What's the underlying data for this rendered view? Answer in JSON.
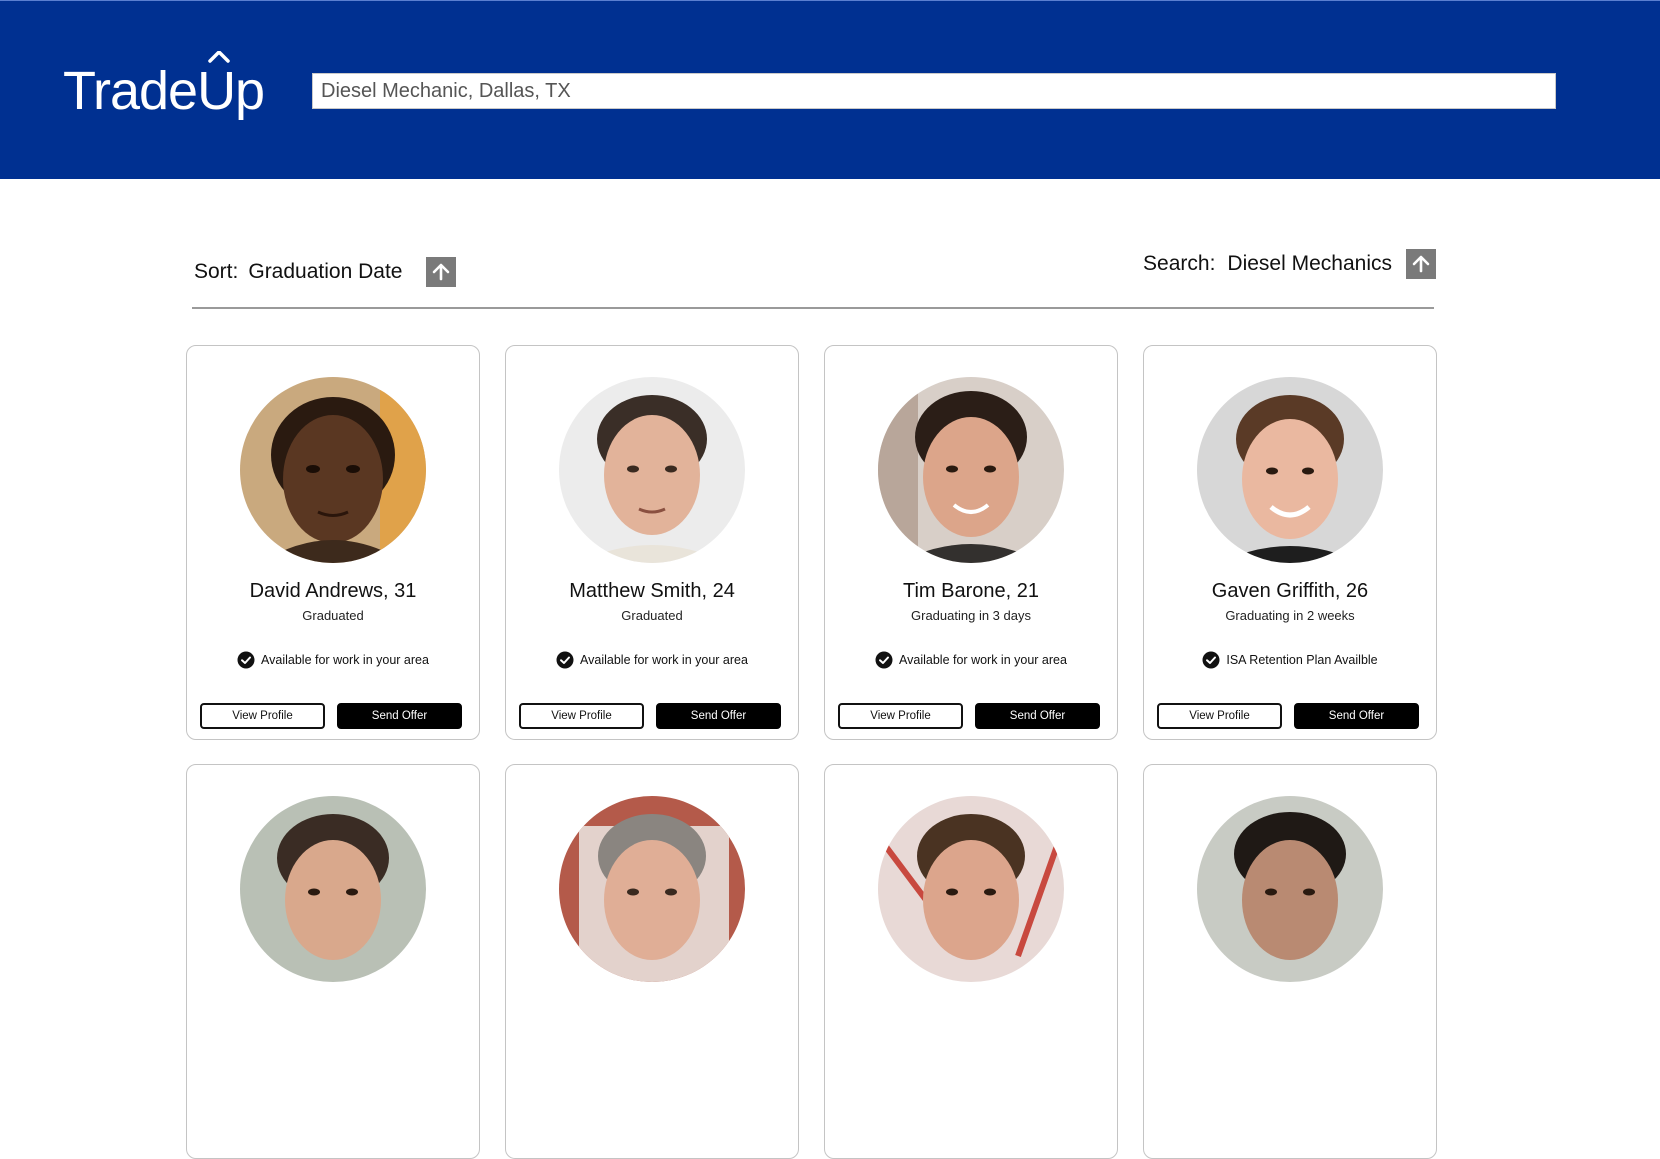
{
  "app": {
    "logo_text_a": "Trade",
    "logo_text_b": "Up",
    "brand_color": "#003091"
  },
  "header": {
    "search_value": "Diesel Mechanic, Dallas, TX"
  },
  "toolbar": {
    "sort_label": "Sort:",
    "sort_value": "Graduation Date",
    "search_label": "Search:",
    "search_value": "Diesel Mechanics",
    "arrow_icon": "arrow-up-icon"
  },
  "candidates": [
    {
      "name": "David Andrews, 31",
      "status": "Graduated",
      "note": "Available for work in your area",
      "view_label": "View Profile",
      "offer_label": "Send Offer"
    },
    {
      "name": "Matthew Smith, 24",
      "status": "Graduated",
      "note": "Available for work in your area",
      "view_label": "View Profile",
      "offer_label": "Send Offer"
    },
    {
      "name": "Tim Barone, 21",
      "status": "Graduating in 3 days",
      "note": "Available for work in your area",
      "view_label": "View Profile",
      "offer_label": "Send Offer"
    },
    {
      "name": "Gaven Griffith, 26",
      "status": "Graduating in 2 weeks",
      "note": "ISA Retention Plan Availble",
      "view_label": "View Profile",
      "offer_label": "Send Offer"
    },
    {
      "name": "",
      "status": "",
      "note": "",
      "view_label": "",
      "offer_label": ""
    },
    {
      "name": "",
      "status": "",
      "note": "",
      "view_label": "",
      "offer_label": ""
    },
    {
      "name": "",
      "status": "",
      "note": "",
      "view_label": "",
      "offer_label": ""
    },
    {
      "name": "",
      "status": "",
      "note": "",
      "view_label": "",
      "offer_label": ""
    }
  ]
}
